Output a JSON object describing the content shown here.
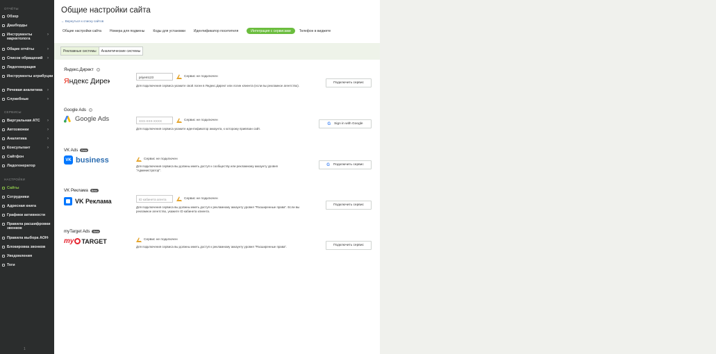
{
  "sidebar": {
    "sections": [
      "ОТЧЁТЫ",
      "СЕРВИСЫ",
      "НАСТРОЙКИ"
    ],
    "reports": [
      {
        "label": "Обзор",
        "chev": false
      },
      {
        "label": "Дашборды",
        "chev": false
      },
      {
        "label": "Инструменты маркетолога",
        "chev": true
      },
      {
        "label": "Общие отчёты",
        "chev": true
      },
      {
        "label": "Список обращений",
        "chev": true
      },
      {
        "label": "Лидогенерация",
        "chev": false
      },
      {
        "label": "Инструменты атрибуции",
        "chev": true
      },
      {
        "label": "Речевая аналитика",
        "chev": true
      },
      {
        "label": "Служебные",
        "chev": true
      }
    ],
    "services": [
      {
        "label": "Виртуальная АТС",
        "chev": true
      },
      {
        "label": "Автозвонки",
        "chev": true
      },
      {
        "label": "Аналитика",
        "chev": true
      },
      {
        "label": "Консультант",
        "chev": true
      },
      {
        "label": "Сайтфон",
        "chev": false
      },
      {
        "label": "Лидогенератор",
        "chev": false
      }
    ],
    "settings": [
      {
        "label": "Сайты",
        "active": true
      },
      {
        "label": "Сотрудники"
      },
      {
        "label": "Адресная книга"
      },
      {
        "label": "Графики активности"
      },
      {
        "label": "Правила расшифровки звонков"
      },
      {
        "label": "Правила выбора АОН",
        "chev": true
      },
      {
        "label": "Блокировка звонков"
      },
      {
        "label": "Уведомления"
      },
      {
        "label": "Теги"
      }
    ],
    "bottom": "1"
  },
  "main": {
    "title": "Общие настройки сайта",
    "back": "← Вернуться к списку сайтов",
    "tabs": [
      "Общие настройки сайта",
      "Номера для подмены",
      "Коды для установки",
      "Идентификатор посетителя",
      "Интеграция с сервисами",
      "Телефон в виджете"
    ],
    "subtabs": [
      "Рекламные системы",
      "Аналитические системы"
    ]
  },
  "services": {
    "yandex": {
      "name": "Яндекс.Директ",
      "logo_text": "Яндекс Директ",
      "field_value": "priyem123",
      "status": "Сервис не подключен",
      "desc": "Для подключения сервиса укажите свой логин в Яндекс.Директ или логин клиента (если вы рекламное агентство).",
      "button": "Подключить сервис"
    },
    "google": {
      "name": "Google Ads",
      "logo_text": "Google Ads",
      "placeholder": "XXX-XXX-XXXX",
      "status": "Сервис не подключен",
      "desc": "Для подключения сервиса укажите идентификатор аккаунта, к которому привязан сайт.",
      "button": "Sign in with Google"
    },
    "vkads": {
      "name": "VK Ads",
      "beta": "Beta",
      "logo_text": "business",
      "status": "Сервис не подключен",
      "desc": "Для подключения сервиса вы должны иметь доступ к сообществу или рекламному аккаунту уровня \"Администратор\".",
      "button": "Подключить сервис"
    },
    "vkreklama": {
      "name": "VK Реклама",
      "beta": "Beta",
      "logo_text": "VK Реклама",
      "placeholder": "ID кабинета агента",
      "status": "Сервис не подключен",
      "desc": "Для подключения сервиса вы должны иметь доступ к рекламному аккаунту уровня \"Расширенные права\". Если вы рекламное агентство, укажите ID кабинета клиента.",
      "button": "Подключить сервис"
    },
    "mytarget": {
      "name": "myTarget Ads",
      "beta": "Beta",
      "logo_text_my": "my",
      "logo_text": "TARGET",
      "status": "Сервис не подключен",
      "desc": "Для подключения сервиса вы должны иметь доступ к рекламному аккаунту уровня \"Расширенные права\".",
      "button": "Подключить сервис"
    }
  },
  "colors": {
    "sidebar": "#2b2d2d",
    "accent": "#6bbd3e",
    "warning": "#e5a42b",
    "vk": "#0077ff",
    "yandex_red": "#e61400",
    "mytarget_red": "#e5232e"
  }
}
